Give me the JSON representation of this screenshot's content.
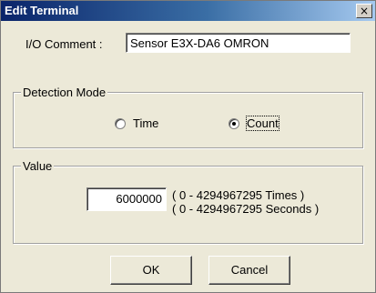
{
  "window": {
    "title": "Edit Terminal",
    "close_glyph": "×"
  },
  "io_comment": {
    "label": "I/O Comment :",
    "value": "Sensor E3X-DA6 OMRON"
  },
  "detection_mode": {
    "legend": "Detection Mode",
    "options": [
      {
        "label": "Time",
        "checked": false
      },
      {
        "label": "Count",
        "checked": true
      }
    ]
  },
  "value_group": {
    "legend": "Value",
    "value": "6000000",
    "range_times": "( 0 - 4294967295 Times )",
    "range_seconds": "( 0 - 4294967295 Seconds )"
  },
  "buttons": {
    "ok": "OK",
    "cancel": "Cancel"
  }
}
